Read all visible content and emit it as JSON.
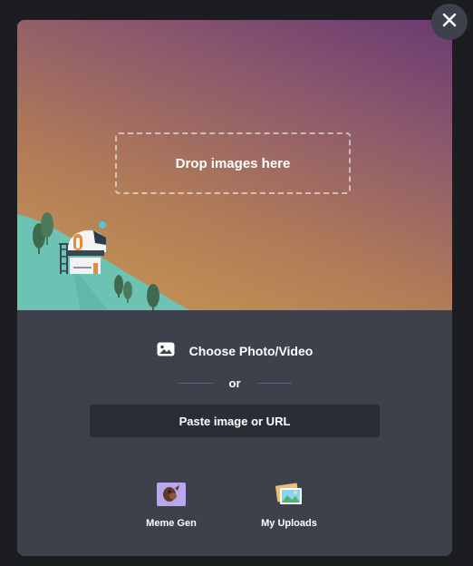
{
  "upload_modal": {
    "dropzone_label": "Drop images here",
    "choose_label": "Choose Photo/Video",
    "or_text": "or",
    "paste_label": "Paste image or URL",
    "tools": [
      {
        "label": "Meme Gen",
        "icon": "meme-gen-icon"
      },
      {
        "label": "My Uploads",
        "icon": "my-uploads-icon"
      }
    ]
  },
  "colors": {
    "modal_bg": "#3c414c",
    "page_bg": "#1b1d21",
    "paste_bg": "#2a2d35",
    "hill": "#6cc3b3",
    "meme_icon_bg": "#b9a6f0"
  }
}
